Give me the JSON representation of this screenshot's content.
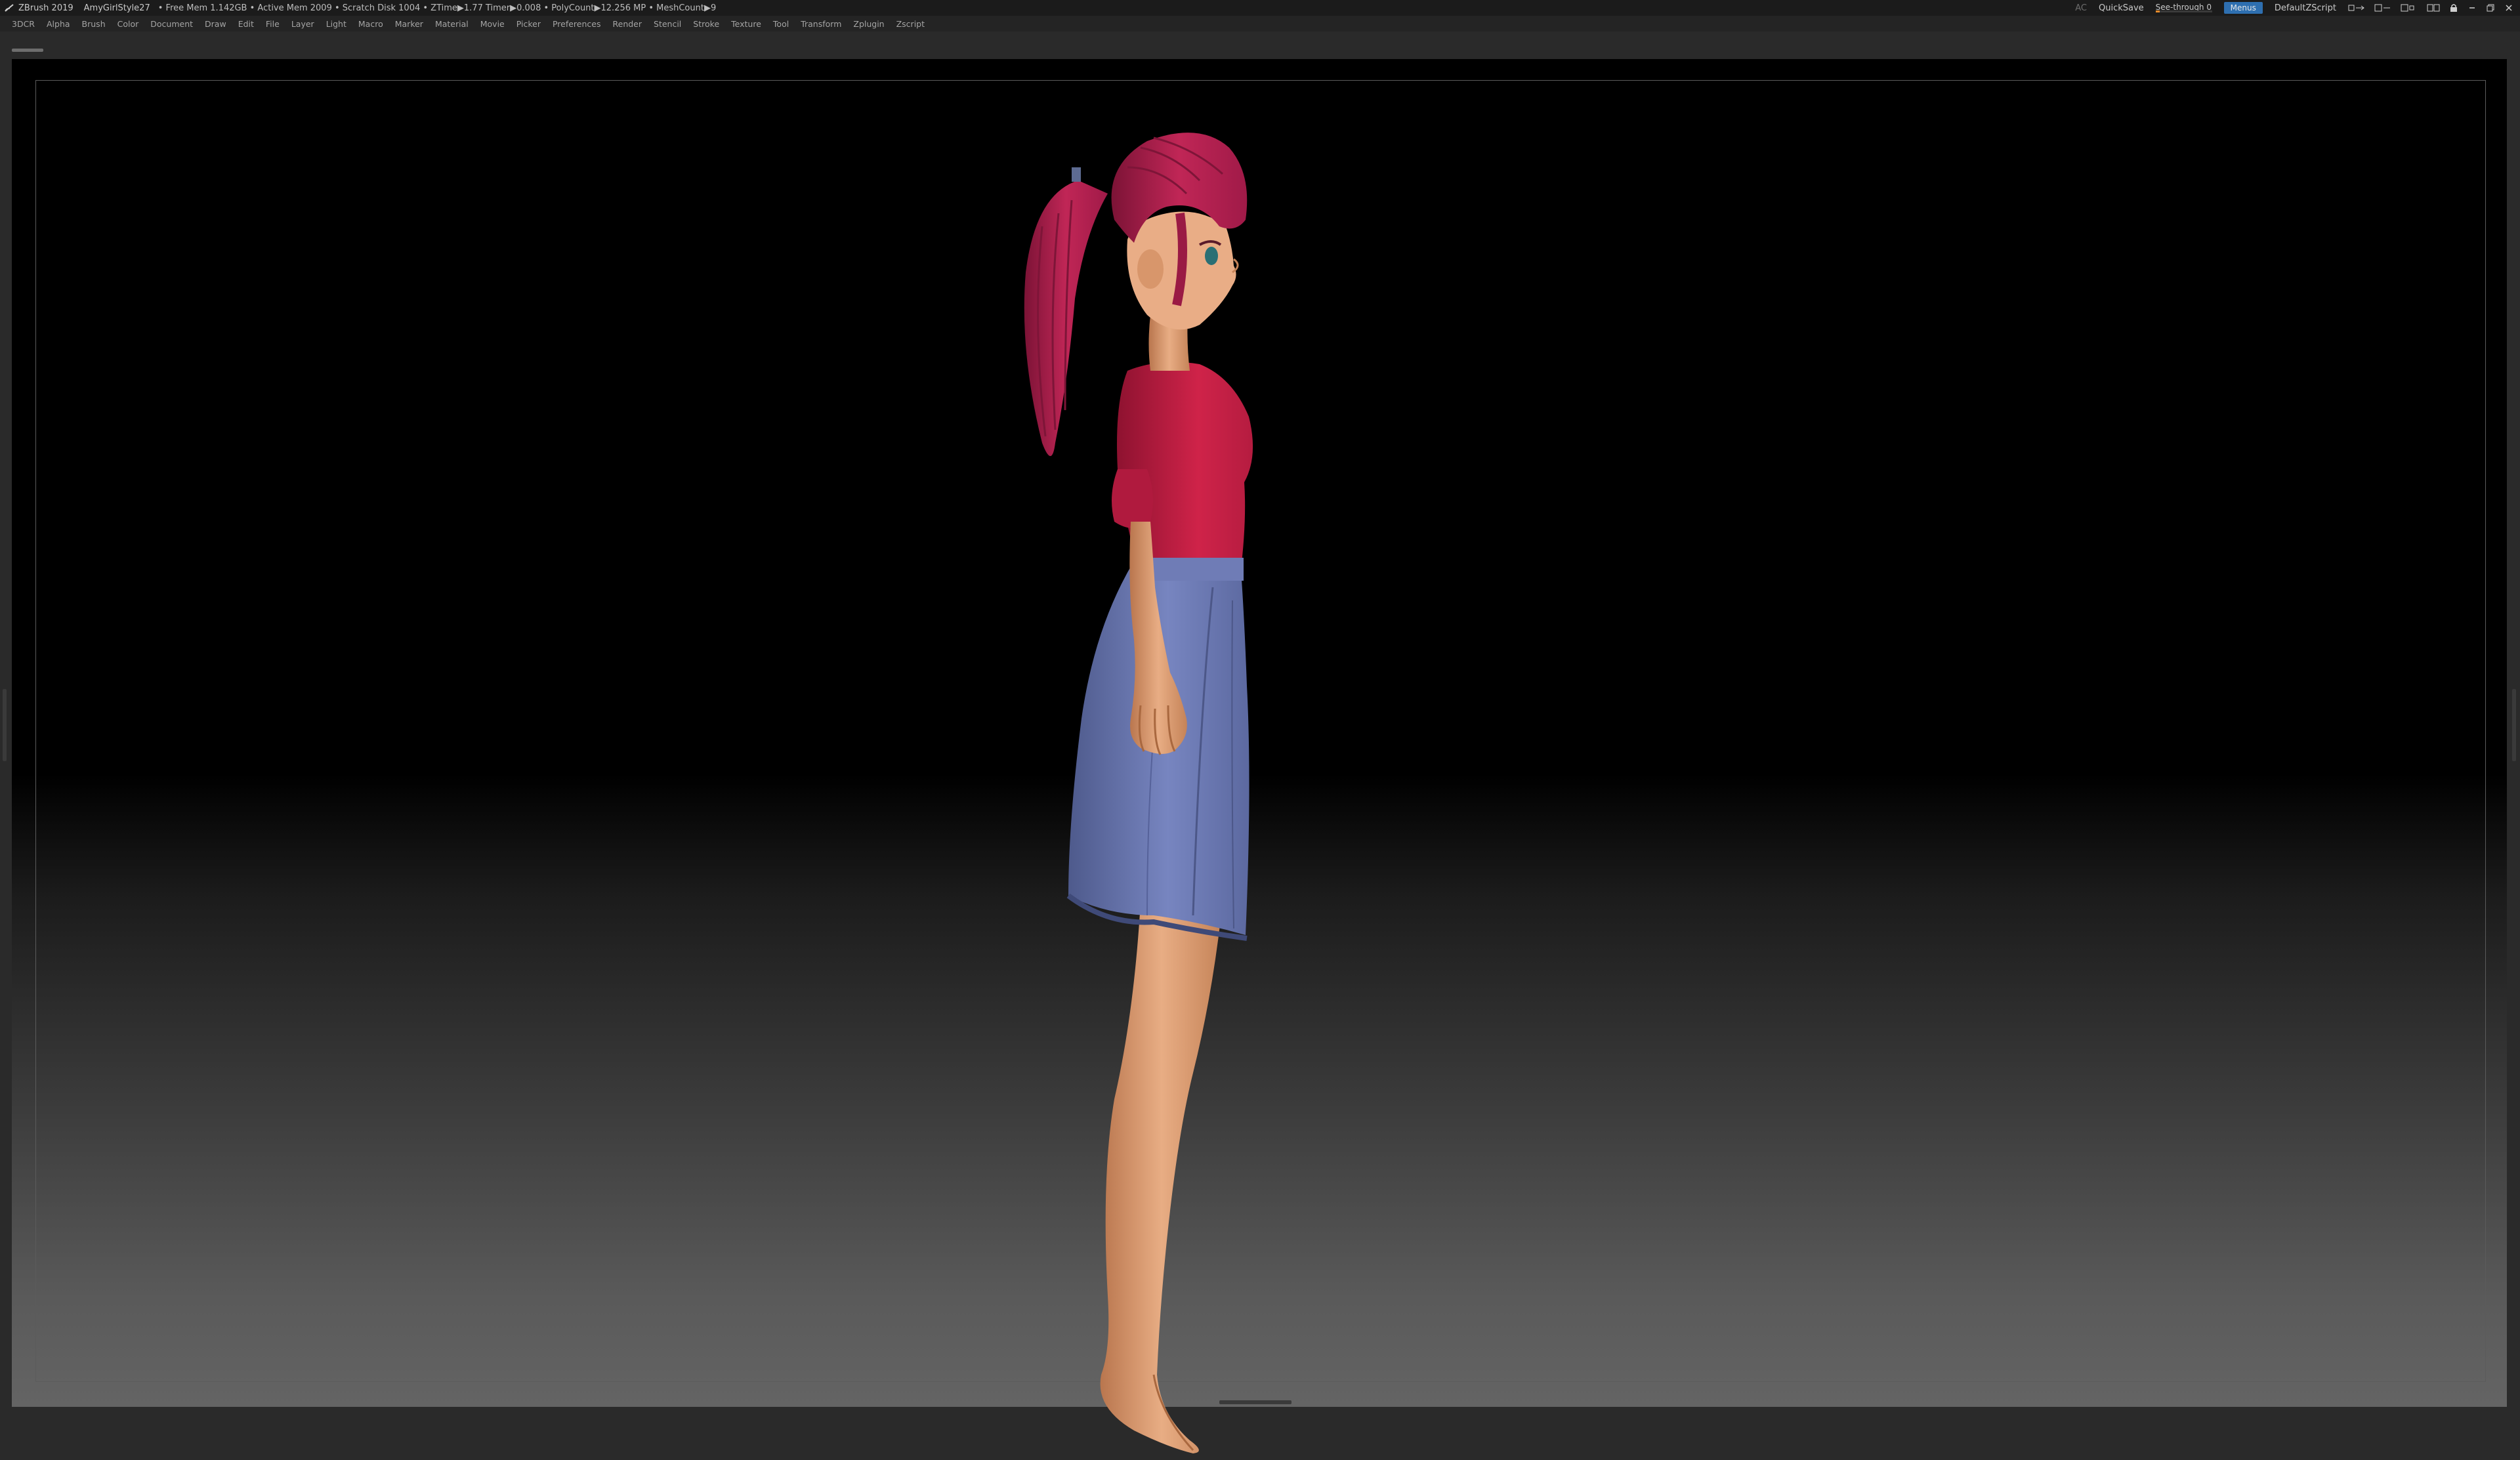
{
  "titlebar": {
    "app": "ZBrush 2019",
    "document": "AmyGirlStyle27",
    "stats": "• Free Mem 1.142GB • Active Mem 2009 • Scratch Disk 1004 • ZTime▶1.77 Timer▶0.008 • PolyCount▶12.256 MP • MeshCount▶9",
    "ac": "AC",
    "quicksave": "QuickSave",
    "see_through_label": "See-through",
    "see_through_value": "0",
    "see_through_level": 0,
    "menus": "Menus",
    "script": "DefaultZScript"
  },
  "menubar": {
    "items": [
      "3DCR",
      "Alpha",
      "Brush",
      "Color",
      "Document",
      "Draw",
      "Edit",
      "File",
      "Layer",
      "Light",
      "Macro",
      "Marker",
      "Material",
      "Movie",
      "Picker",
      "Preferences",
      "Render",
      "Stencil",
      "Stroke",
      "Texture",
      "Tool",
      "Transform",
      "Zplugin",
      "Zscript"
    ]
  },
  "colors": {
    "accent_orange": "#e58a2b",
    "menus_blue": "#2e6fb0",
    "hair": "#b0204f",
    "shirt": "#c21d46",
    "skirt": "#6e7cb4",
    "skin": "#e3a379"
  },
  "icons": [
    "zbrush-logo-icon",
    "minimize-icon",
    "restore-icon",
    "close-icon"
  ]
}
